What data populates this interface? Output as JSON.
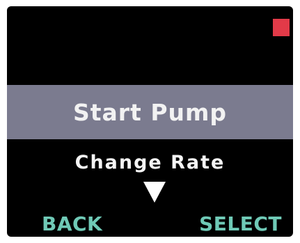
{
  "menu": {
    "selected_item": "Start Pump",
    "next_item": "Change Rate",
    "scroll_indicator_icon": "triangle-down-icon"
  },
  "status": {
    "indicator_color": "#e23a48"
  },
  "softkeys": {
    "left_label": "BACK",
    "right_label": "SELECT"
  },
  "colors": {
    "background": "#000000",
    "highlight": "#7b7b8f",
    "softkey_text": "#6fc9b6"
  }
}
